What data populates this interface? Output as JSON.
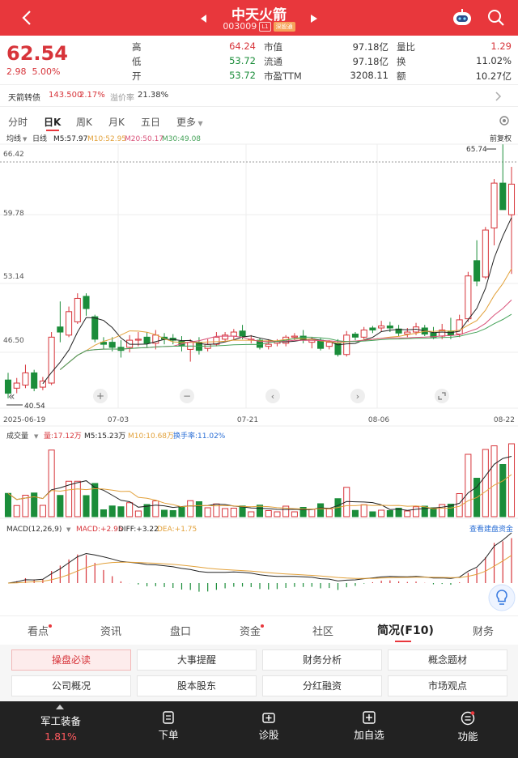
{
  "header": {
    "title": "中天火箭",
    "code": "003009",
    "badge1": "L1",
    "badge2": "深股通"
  },
  "quote": {
    "price": "62.54",
    "change": "2.98",
    "change_pct": "5.00%",
    "rows": [
      {
        "l1": "高",
        "v1": "64.24",
        "l2": "市值",
        "v2": "97.18亿",
        "l3": "量比",
        "v3": "1.29"
      },
      {
        "l1": "低",
        "v1": "53.72",
        "l2": "流通",
        "v2": "97.18亿",
        "l3": "换",
        "v3": "11.02%"
      },
      {
        "l1": "开",
        "v1": "53.72",
        "l2": "市盈TTM",
        "v2": "3208.11",
        "l3": "额",
        "v3": "10.27亿"
      }
    ]
  },
  "bond": {
    "name": "天箭转债",
    "price": "143.500",
    "pct": "2.17%",
    "premium_label": "溢价率",
    "premium": "21.38%"
  },
  "period_tabs": [
    "分时",
    "日K",
    "周K",
    "月K",
    "五日",
    "更多"
  ],
  "kline": {
    "ma_select": "均线",
    "period": "日线",
    "ma5": "M5:57.97",
    "ma10": "M10:52.95",
    "ma20": "M20:50.17",
    "ma30": "M30:49.08",
    "adj": "前复权",
    "y_ticks": [
      "66.42",
      "59.78",
      "53.14",
      "46.50"
    ],
    "max_label": "65.74",
    "min_label": "40.54",
    "dates": [
      "2025-06-19",
      "07-03",
      "07-21",
      "08-06",
      "08-22"
    ]
  },
  "volume": {
    "label": "成交量",
    "v": "量:17.12万",
    "m5": "M5:15.23万",
    "m10": "M10:10.68万",
    "turnover": "换手率:11.02%"
  },
  "macd": {
    "label": "MACD(12,26,9)",
    "macd": "MACD:+2.95",
    "diff": "DIFF:+3.22",
    "dea": "DEA:+1.75",
    "link": "查看建盘资金"
  },
  "bottom_tabs": [
    "看点",
    "资讯",
    "盘口",
    "资金",
    "社区",
    "简况(F10)",
    "财务"
  ],
  "grid": [
    "操盘必读",
    "大事提醒",
    "财务分析",
    "概念题材",
    "公司概况",
    "股本股东",
    "分红融资",
    "市场观点"
  ],
  "bottom_bar": {
    "sector": "军工装备",
    "sector_pct": "1.81%",
    "b1": "下单",
    "b2": "诊股",
    "b3": "加自选",
    "b4": "功能"
  },
  "colors": {
    "up": "#d7343a",
    "down": "#1b8d3a",
    "header": "#e8373c"
  },
  "chart_data": {
    "type": "candlestick",
    "ylim": [
      40.54,
      66.42
    ],
    "candles": [
      [
        43.3,
        42.0,
        44.0,
        41.5
      ],
      [
        42.5,
        43.0,
        43.5,
        42.0
      ],
      [
        42.8,
        44.0,
        44.8,
        42.5
      ],
      [
        44.0,
        42.5,
        44.3,
        42.2
      ],
      [
        42.6,
        43.2,
        43.6,
        42.3
      ],
      [
        43.0,
        47.5,
        48.0,
        42.8
      ],
      [
        48.5,
        48.0,
        51.0,
        47.0
      ],
      [
        47.7,
        50.0,
        50.5,
        47.5
      ],
      [
        49.0,
        51.3,
        51.8,
        48.8
      ],
      [
        51.5,
        50.3,
        51.8,
        49.6
      ],
      [
        49.5,
        47.3,
        49.7,
        47.0
      ],
      [
        47.0,
        46.8,
        47.5,
        46.3
      ],
      [
        47.0,
        46.5,
        47.5,
        46.1
      ],
      [
        46.5,
        46.2,
        47.2,
        45.5
      ],
      [
        46.5,
        47.2,
        47.7,
        46.0
      ],
      [
        47.3,
        47.3,
        48.0,
        46.6
      ],
      [
        47.5,
        46.9,
        48.0,
        46.5
      ],
      [
        46.9,
        47.7,
        48.2,
        46.3
      ],
      [
        47.5,
        47.3,
        47.9,
        46.8
      ],
      [
        47.4,
        47.2,
        47.8,
        46.8
      ],
      [
        47.1,
        46.7,
        47.6,
        46.1
      ],
      [
        46.3,
        47.0,
        47.3,
        45.1
      ],
      [
        47.0,
        46.2,
        47.5,
        45.8
      ],
      [
        46.4,
        46.8,
        47.3,
        46.1
      ],
      [
        46.8,
        47.5,
        48.0,
        46.6
      ],
      [
        47.3,
        47.7,
        48.0,
        47.0
      ],
      [
        47.6,
        48.0,
        48.3,
        47.2
      ],
      [
        48.1,
        47.6,
        48.7,
        47.3
      ],
      [
        47.3,
        47.3,
        47.7,
        46.9
      ],
      [
        47.2,
        46.5,
        47.4,
        46.3
      ],
      [
        46.6,
        46.8,
        47.3,
        46.3
      ],
      [
        46.9,
        47.1,
        47.3,
        46.6
      ],
      [
        46.9,
        47.5,
        47.7,
        46.6
      ],
      [
        47.5,
        47.6,
        47.9,
        47.2
      ],
      [
        47.6,
        47.2,
        48.2,
        46.9
      ],
      [
        47.0,
        47.3,
        47.5,
        46.4
      ],
      [
        47.2,
        46.4,
        47.4,
        46.2
      ],
      [
        46.6,
        47.0,
        47.2,
        46.3
      ],
      [
        46.9,
        45.8,
        47.3,
        45.6
      ],
      [
        45.8,
        47.7,
        48.1,
        45.6
      ],
      [
        47.8,
        47.5,
        48.0,
        47.2
      ],
      [
        47.5,
        48.2,
        48.5,
        47.3
      ],
      [
        48.4,
        48.2,
        48.6,
        47.9
      ],
      [
        48.4,
        48.6,
        49.1,
        48.0
      ],
      [
        48.6,
        48.4,
        49.0,
        48.0
      ],
      [
        48.3,
        47.9,
        48.7,
        47.6
      ],
      [
        47.8,
        48.0,
        48.4,
        47.5
      ],
      [
        48.0,
        48.5,
        48.9,
        47.7
      ],
      [
        48.4,
        47.8,
        48.7,
        47.6
      ],
      [
        47.9,
        47.5,
        48.5,
        47.3
      ],
      [
        47.6,
        48.2,
        48.8,
        47.3
      ],
      [
        48.1,
        47.7,
        49.4,
        47.3
      ],
      [
        47.8,
        49.2,
        49.7,
        47.5
      ],
      [
        49.3,
        53.5,
        53.9,
        49.0
      ],
      [
        55.0,
        53.0,
        57.0,
        52.5
      ],
      [
        53.4,
        58.0,
        58.3,
        53.2
      ],
      [
        58.2,
        62.6,
        63.0,
        56.5
      ],
      [
        62.6,
        60.0,
        66.4,
        60.0
      ],
      [
        59.5,
        62.5,
        64.2,
        53.7
      ]
    ]
  }
}
